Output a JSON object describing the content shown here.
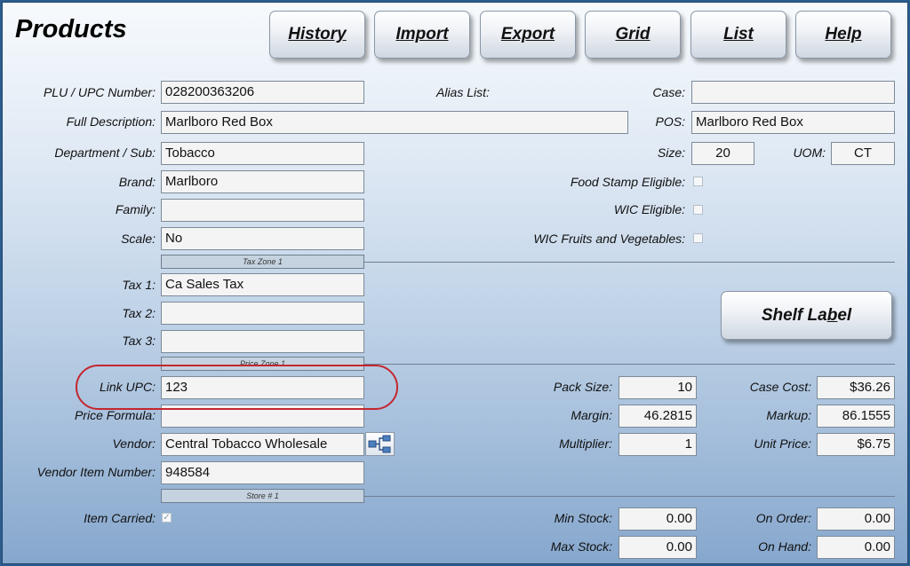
{
  "header": {
    "title": "Products"
  },
  "toolbar": {
    "history": "History",
    "import": "Import",
    "export": "Export",
    "grid": "Grid",
    "list": "List",
    "help": "Help"
  },
  "labels": {
    "plu_upc": "PLU / UPC Number:",
    "full_description": "Full Description:",
    "department": "Department / Sub:",
    "brand": "Brand:",
    "family": "Family:",
    "scale": "Scale:",
    "tax1": "Tax 1:",
    "tax2": "Tax 2:",
    "tax3": "Tax 3:",
    "link_upc": "Link UPC:",
    "price_formula": "Price Formula:",
    "vendor": "Vendor:",
    "vendor_item_number": "Vendor Item Number:",
    "item_carried": "Item Carried:",
    "alias_list": "Alias List:",
    "case": "Case:",
    "pos": "POS:",
    "size": "Size:",
    "uom": "UOM:",
    "food_stamp": "Food Stamp Eligible:",
    "wic": "WIC Eligible:",
    "wic_fruits": "WIC Fruits and Vegetables:",
    "pack_size": "Pack Size:",
    "margin": "Margin:",
    "multiplier": "Multiplier:",
    "case_cost": "Case Cost:",
    "markup": "Markup:",
    "unit_price": "Unit Price:",
    "min_stock": "Min Stock:",
    "max_stock": "Max Stock:",
    "on_order": "On Order:",
    "on_hand": "On Hand:"
  },
  "values": {
    "plu_upc": "028200363206",
    "full_description": "Marlboro Red Box",
    "department": "Tobacco",
    "brand": "Marlboro",
    "family": "",
    "scale": "No",
    "tax1": "Ca Sales Tax",
    "tax2": "",
    "tax3": "",
    "link_upc": "123",
    "price_formula": "",
    "vendor": "Central Tobacco Wholesale",
    "vendor_item_number": "948584",
    "case": "",
    "pos": "Marlboro Red Box",
    "size": "20",
    "uom": "CT",
    "pack_size": "10",
    "margin": "46.2815",
    "multiplier": "1",
    "case_cost": "$36.26",
    "markup": "86.1555",
    "unit_price": "$6.75",
    "min_stock": "0.00",
    "max_stock": "0.00",
    "on_order": "0.00",
    "on_hand": "0.00"
  },
  "checkboxes": {
    "food_stamp": false,
    "wic": false,
    "wic_fruits": false,
    "item_carried": true
  },
  "zones": {
    "tax_zone": "Tax Zone 1",
    "price_zone": "Price Zone 1",
    "store": "Store # 1"
  },
  "buttons": {
    "shelf_label": "Shelf Label"
  },
  "icons": {
    "vendor_lookup": "vendor-lookup-icon"
  },
  "colors": {
    "annotation": "#c4262e",
    "background_top": "#f7fafd",
    "background_bottom": "#86a7cd"
  }
}
